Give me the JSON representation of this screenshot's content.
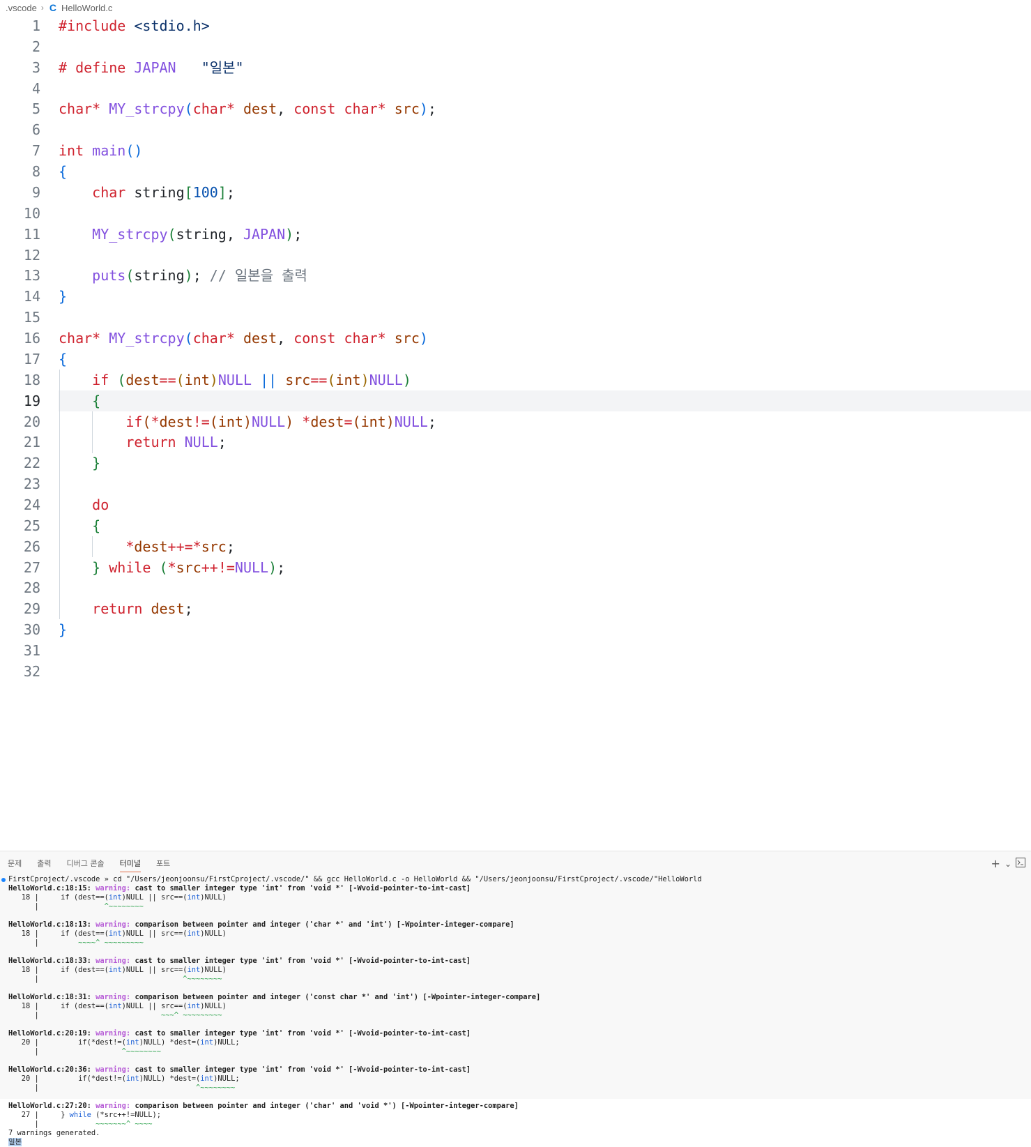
{
  "breadcrumb": {
    "folder": ".vscode",
    "file_icon": "c-language-icon",
    "file": "HelloWorld.c"
  },
  "editor": {
    "current_line": 19,
    "lines": [
      {
        "n": "1",
        "tokens": [
          {
            "t": "#include",
            "c": "kw"
          },
          {
            "t": " "
          },
          {
            "t": "<stdio.h>",
            "c": "str"
          }
        ]
      },
      {
        "n": "2",
        "tokens": []
      },
      {
        "n": "3",
        "tokens": [
          {
            "t": "# define",
            "c": "kw"
          },
          {
            "t": " "
          },
          {
            "t": "JAPAN",
            "c": "fn"
          },
          {
            "t": "   "
          },
          {
            "t": "\"일본\"",
            "c": "str"
          }
        ]
      },
      {
        "n": "4",
        "tokens": []
      },
      {
        "n": "5",
        "tokens": [
          {
            "t": "char",
            "c": "kw"
          },
          {
            "t": "*",
            "c": "kw"
          },
          {
            "t": " "
          },
          {
            "t": "MY_strcpy",
            "c": "fn"
          },
          {
            "t": "(",
            "c": "b1"
          },
          {
            "t": "char",
            "c": "kw"
          },
          {
            "t": "*",
            "c": "kw"
          },
          {
            "t": " "
          },
          {
            "t": "dest",
            "c": "pm"
          },
          {
            "t": ", "
          },
          {
            "t": "const",
            "c": "kw"
          },
          {
            "t": " "
          },
          {
            "t": "char",
            "c": "kw"
          },
          {
            "t": "*",
            "c": "kw"
          },
          {
            "t": " "
          },
          {
            "t": "src",
            "c": "pm"
          },
          {
            "t": ")",
            "c": "b1"
          },
          {
            "t": ";"
          }
        ]
      },
      {
        "n": "6",
        "tokens": []
      },
      {
        "n": "7",
        "tokens": [
          {
            "t": "int",
            "c": "kw"
          },
          {
            "t": " "
          },
          {
            "t": "main",
            "c": "fn"
          },
          {
            "t": "()",
            "c": "b1"
          }
        ]
      },
      {
        "n": "8",
        "tokens": [
          {
            "t": "{",
            "c": "b1"
          }
        ]
      },
      {
        "n": "9",
        "tokens": [
          {
            "t": "    "
          },
          {
            "t": "char",
            "c": "kw"
          },
          {
            "t": " string"
          },
          {
            "t": "[",
            "c": "b2"
          },
          {
            "t": "100",
            "c": "num"
          },
          {
            "t": "]",
            "c": "b2"
          },
          {
            "t": ";"
          }
        ]
      },
      {
        "n": "10",
        "tokens": []
      },
      {
        "n": "11",
        "tokens": [
          {
            "t": "    "
          },
          {
            "t": "MY_strcpy",
            "c": "fn"
          },
          {
            "t": "(",
            "c": "b2"
          },
          {
            "t": "string, "
          },
          {
            "t": "JAPAN",
            "c": "fn"
          },
          {
            "t": ")",
            "c": "b2"
          },
          {
            "t": ";"
          }
        ]
      },
      {
        "n": "12",
        "tokens": []
      },
      {
        "n": "13",
        "tokens": [
          {
            "t": "    "
          },
          {
            "t": "puts",
            "c": "fn"
          },
          {
            "t": "(",
            "c": "b2"
          },
          {
            "t": "string"
          },
          {
            "t": ")",
            "c": "b2"
          },
          {
            "t": "; "
          },
          {
            "t": "// 일본을 출력",
            "c": "cm"
          }
        ]
      },
      {
        "n": "14",
        "tokens": [
          {
            "t": "}",
            "c": "b1"
          }
        ]
      },
      {
        "n": "15",
        "tokens": []
      },
      {
        "n": "16",
        "tokens": [
          {
            "t": "char",
            "c": "kw"
          },
          {
            "t": "*",
            "c": "kw"
          },
          {
            "t": " "
          },
          {
            "t": "MY_strcpy",
            "c": "fn"
          },
          {
            "t": "(",
            "c": "b1"
          },
          {
            "t": "char",
            "c": "kw"
          },
          {
            "t": "*",
            "c": "kw"
          },
          {
            "t": " "
          },
          {
            "t": "dest",
            "c": "pm"
          },
          {
            "t": ", "
          },
          {
            "t": "const",
            "c": "kw"
          },
          {
            "t": " "
          },
          {
            "t": "char",
            "c": "kw"
          },
          {
            "t": "*",
            "c": "kw"
          },
          {
            "t": " "
          },
          {
            "t": "src",
            "c": "pm"
          },
          {
            "t": ")",
            "c": "b1"
          }
        ]
      },
      {
        "n": "17",
        "tokens": [
          {
            "t": "{",
            "c": "b1"
          }
        ]
      },
      {
        "n": "18",
        "tokens": [
          {
            "t": "    "
          },
          {
            "t": "if",
            "c": "kw"
          },
          {
            "t": " "
          },
          {
            "t": "(",
            "c": "b2"
          },
          {
            "t": "dest",
            "c": "pm"
          },
          {
            "t": "==",
            "c": "kw"
          },
          {
            "t": "(",
            "c": "b3"
          },
          {
            "t": "int",
            "c": "pm"
          },
          {
            "t": ")",
            "c": "b3"
          },
          {
            "t": "NULL",
            "c": "fn"
          },
          {
            "t": " "
          },
          {
            "t": "||",
            "c": "b1"
          },
          {
            "t": " "
          },
          {
            "t": "src",
            "c": "pm"
          },
          {
            "t": "==",
            "c": "kw"
          },
          {
            "t": "(",
            "c": "b3"
          },
          {
            "t": "int",
            "c": "pm"
          },
          {
            "t": ")",
            "c": "b3"
          },
          {
            "t": "NULL",
            "c": "fn"
          },
          {
            "t": ")",
            "c": "b2"
          }
        ]
      },
      {
        "n": "19",
        "tokens": [
          {
            "t": "    "
          },
          {
            "t": "{",
            "c": "b2"
          }
        ]
      },
      {
        "n": "20",
        "tokens": [
          {
            "t": "        "
          },
          {
            "t": "if",
            "c": "kw"
          },
          {
            "t": "(",
            "c": "pm"
          },
          {
            "t": "*",
            "c": "kw"
          },
          {
            "t": "dest",
            "c": "pm"
          },
          {
            "t": "!=",
            "c": "kw"
          },
          {
            "t": "(",
            "c": "pm"
          },
          {
            "t": "int",
            "c": "pm"
          },
          {
            "t": ")",
            "c": "pm"
          },
          {
            "t": "NULL",
            "c": "fn"
          },
          {
            "t": ")",
            "c": "pm"
          },
          {
            "t": " "
          },
          {
            "t": "*",
            "c": "kw"
          },
          {
            "t": "dest",
            "c": "pm"
          },
          {
            "t": "=",
            "c": "kw"
          },
          {
            "t": "(",
            "c": "pm"
          },
          {
            "t": "int",
            "c": "pm"
          },
          {
            "t": ")",
            "c": "pm"
          },
          {
            "t": "NULL",
            "c": "fn"
          },
          {
            "t": ";"
          }
        ]
      },
      {
        "n": "21",
        "tokens": [
          {
            "t": "        "
          },
          {
            "t": "return",
            "c": "kw"
          },
          {
            "t": " "
          },
          {
            "t": "NULL",
            "c": "fn"
          },
          {
            "t": ";"
          }
        ]
      },
      {
        "n": "22",
        "tokens": [
          {
            "t": "    "
          },
          {
            "t": "}",
            "c": "b2"
          }
        ]
      },
      {
        "n": "23",
        "tokens": []
      },
      {
        "n": "24",
        "tokens": [
          {
            "t": "    "
          },
          {
            "t": "do",
            "c": "kw"
          }
        ]
      },
      {
        "n": "25",
        "tokens": [
          {
            "t": "    "
          },
          {
            "t": "{",
            "c": "b2"
          }
        ]
      },
      {
        "n": "26",
        "tokens": [
          {
            "t": "        "
          },
          {
            "t": "*",
            "c": "kw"
          },
          {
            "t": "dest",
            "c": "pm"
          },
          {
            "t": "++=",
            "c": "kw"
          },
          {
            "t": "*",
            "c": "kw"
          },
          {
            "t": "src",
            "c": "pm"
          },
          {
            "t": ";"
          }
        ]
      },
      {
        "n": "27",
        "tokens": [
          {
            "t": "    "
          },
          {
            "t": "}",
            "c": "b2"
          },
          {
            "t": " "
          },
          {
            "t": "while",
            "c": "kw"
          },
          {
            "t": " "
          },
          {
            "t": "(",
            "c": "b2"
          },
          {
            "t": "*",
            "c": "kw"
          },
          {
            "t": "src",
            "c": "pm"
          },
          {
            "t": "++!=",
            "c": "kw"
          },
          {
            "t": "NULL",
            "c": "fn"
          },
          {
            "t": ")",
            "c": "b2"
          },
          {
            "t": ";"
          }
        ]
      },
      {
        "n": "28",
        "tokens": []
      },
      {
        "n": "29",
        "tokens": [
          {
            "t": "    "
          },
          {
            "t": "return",
            "c": "kw"
          },
          {
            "t": " "
          },
          {
            "t": "dest",
            "c": "pm"
          },
          {
            "t": ";"
          }
        ]
      },
      {
        "n": "30",
        "tokens": [
          {
            "t": "}",
            "c": "b1"
          }
        ]
      },
      {
        "n": "31",
        "tokens": []
      },
      {
        "n": "32",
        "tokens": []
      }
    ]
  },
  "panel": {
    "tabs": [
      {
        "label": "문제",
        "active": false
      },
      {
        "label": "출력",
        "active": false
      },
      {
        "label": "디버그 콘솔",
        "active": false
      },
      {
        "label": "터미널",
        "active": true
      },
      {
        "label": "포트",
        "active": false
      }
    ],
    "actions": {
      "add": "+",
      "dropdown": "⌄",
      "terminal_icon": "terminal-icon"
    }
  },
  "terminal": {
    "lines": [
      {
        "dot": true,
        "parts": [
          {
            "t": "FirstCproject/.vscode » cd \"/Users/jeonjoonsu/FirstCproject/.vscode/\" && gcc HelloWorld.c -o HelloWorld && \"/Users/jeonjoonsu/FirstCproject/.vscode/\"HelloWorld"
          }
        ]
      },
      {
        "parts": [
          {
            "t": "HelloWorld.c:18:15: ",
            "c": "fileloc"
          },
          {
            "t": "warning: ",
            "c": "warn"
          },
          {
            "t": "cast to smaller integer type 'int' from 'void *' [-Wvoid-pointer-to-int-cast]",
            "c": "wmsg"
          }
        ]
      },
      {
        "parts": [
          {
            "t": "   18 |     if (dest==("
          },
          {
            "t": "int",
            "c": "tkw"
          },
          {
            "t": ")NULL || src==("
          },
          {
            "t": "int",
            "c": "tkw"
          },
          {
            "t": ")NULL)"
          }
        ]
      },
      {
        "parts": [
          {
            "t": "      |               "
          },
          {
            "t": "^~~~~~~~~",
            "c": "caret"
          }
        ]
      },
      {
        "parts": [
          {
            "t": ""
          }
        ]
      },
      {
        "parts": [
          {
            "t": "HelloWorld.c:18:13: ",
            "c": "fileloc"
          },
          {
            "t": "warning: ",
            "c": "warn"
          },
          {
            "t": "comparison between pointer and integer ('char *' and 'int') [-Wpointer-integer-compare]",
            "c": "wmsg"
          }
        ]
      },
      {
        "parts": [
          {
            "t": "   18 |     if (dest==("
          },
          {
            "t": "int",
            "c": "tkw"
          },
          {
            "t": ")NULL || src==("
          },
          {
            "t": "int",
            "c": "tkw"
          },
          {
            "t": ")NULL)"
          }
        ]
      },
      {
        "parts": [
          {
            "t": "      |         "
          },
          {
            "t": "~~~~^ ~~~~~~~~~",
            "c": "caret"
          }
        ]
      },
      {
        "parts": [
          {
            "t": ""
          }
        ]
      },
      {
        "parts": [
          {
            "t": "HelloWorld.c:18:33: ",
            "c": "fileloc"
          },
          {
            "t": "warning: ",
            "c": "warn"
          },
          {
            "t": "cast to smaller integer type 'int' from 'void *' [-Wvoid-pointer-to-int-cast]",
            "c": "wmsg"
          }
        ]
      },
      {
        "parts": [
          {
            "t": "   18 |     if (dest==("
          },
          {
            "t": "int",
            "c": "tkw"
          },
          {
            "t": ")NULL || src==("
          },
          {
            "t": "int",
            "c": "tkw"
          },
          {
            "t": ")NULL)"
          }
        ]
      },
      {
        "parts": [
          {
            "t": "      |                                 "
          },
          {
            "t": "^~~~~~~~~",
            "c": "caret"
          }
        ]
      },
      {
        "parts": [
          {
            "t": ""
          }
        ]
      },
      {
        "parts": [
          {
            "t": "HelloWorld.c:18:31: ",
            "c": "fileloc"
          },
          {
            "t": "warning: ",
            "c": "warn"
          },
          {
            "t": "comparison between pointer and integer ('const char *' and 'int') [-Wpointer-integer-compare]",
            "c": "wmsg"
          }
        ]
      },
      {
        "parts": [
          {
            "t": "   18 |     if (dest==("
          },
          {
            "t": "int",
            "c": "tkw"
          },
          {
            "t": ")NULL || src==("
          },
          {
            "t": "int",
            "c": "tkw"
          },
          {
            "t": ")NULL)"
          }
        ]
      },
      {
        "parts": [
          {
            "t": "      |                            "
          },
          {
            "t": "~~~^ ~~~~~~~~~",
            "c": "caret"
          }
        ]
      },
      {
        "parts": [
          {
            "t": ""
          }
        ]
      },
      {
        "parts": [
          {
            "t": "HelloWorld.c:20:19: ",
            "c": "fileloc"
          },
          {
            "t": "warning: ",
            "c": "warn"
          },
          {
            "t": "cast to smaller integer type 'int' from 'void *' [-Wvoid-pointer-to-int-cast]",
            "c": "wmsg"
          }
        ]
      },
      {
        "parts": [
          {
            "t": "   20 |         if(*dest!=("
          },
          {
            "t": "int",
            "c": "tkw"
          },
          {
            "t": ")NULL) *dest=("
          },
          {
            "t": "int",
            "c": "tkw"
          },
          {
            "t": ")NULL;"
          }
        ]
      },
      {
        "parts": [
          {
            "t": "      |                   "
          },
          {
            "t": "^~~~~~~~~",
            "c": "caret"
          }
        ]
      },
      {
        "parts": [
          {
            "t": ""
          }
        ]
      },
      {
        "parts": [
          {
            "t": "HelloWorld.c:20:36: ",
            "c": "fileloc"
          },
          {
            "t": "warning: ",
            "c": "warn"
          },
          {
            "t": "cast to smaller integer type 'int' from 'void *' [-Wvoid-pointer-to-int-cast]",
            "c": "wmsg"
          }
        ]
      },
      {
        "parts": [
          {
            "t": "   20 |         if(*dest!=("
          },
          {
            "t": "int",
            "c": "tkw"
          },
          {
            "t": ")NULL) *dest=("
          },
          {
            "t": "int",
            "c": "tkw"
          },
          {
            "t": ")NULL;"
          }
        ]
      },
      {
        "parts": [
          {
            "t": "      |                                    "
          },
          {
            "t": "^~~~~~~~~",
            "c": "caret"
          }
        ]
      },
      {
        "parts": [
          {
            "t": ""
          }
        ]
      },
      {
        "parts": [
          {
            "t": "HelloWorld.c:27:20: ",
            "c": "fileloc"
          },
          {
            "t": "warning: ",
            "c": "warn"
          },
          {
            "t": "comparison between pointer and integer ('char' and 'void *') [-Wpointer-integer-compare]",
            "c": "wmsg"
          }
        ]
      },
      {
        "parts": [
          {
            "t": "   27 |     } "
          },
          {
            "t": "while",
            "c": "tkw"
          },
          {
            "t": " (*src++!=NULL);"
          }
        ]
      },
      {
        "parts": [
          {
            "t": "      |             "
          },
          {
            "t": "~~~~~~~^ ~~~~",
            "c": "caret"
          }
        ]
      },
      {
        "parts": [
          {
            "t": "7 warnings generated."
          }
        ]
      },
      {
        "parts": [
          {
            "t": "일본",
            "c": "sel"
          }
        ]
      }
    ]
  }
}
